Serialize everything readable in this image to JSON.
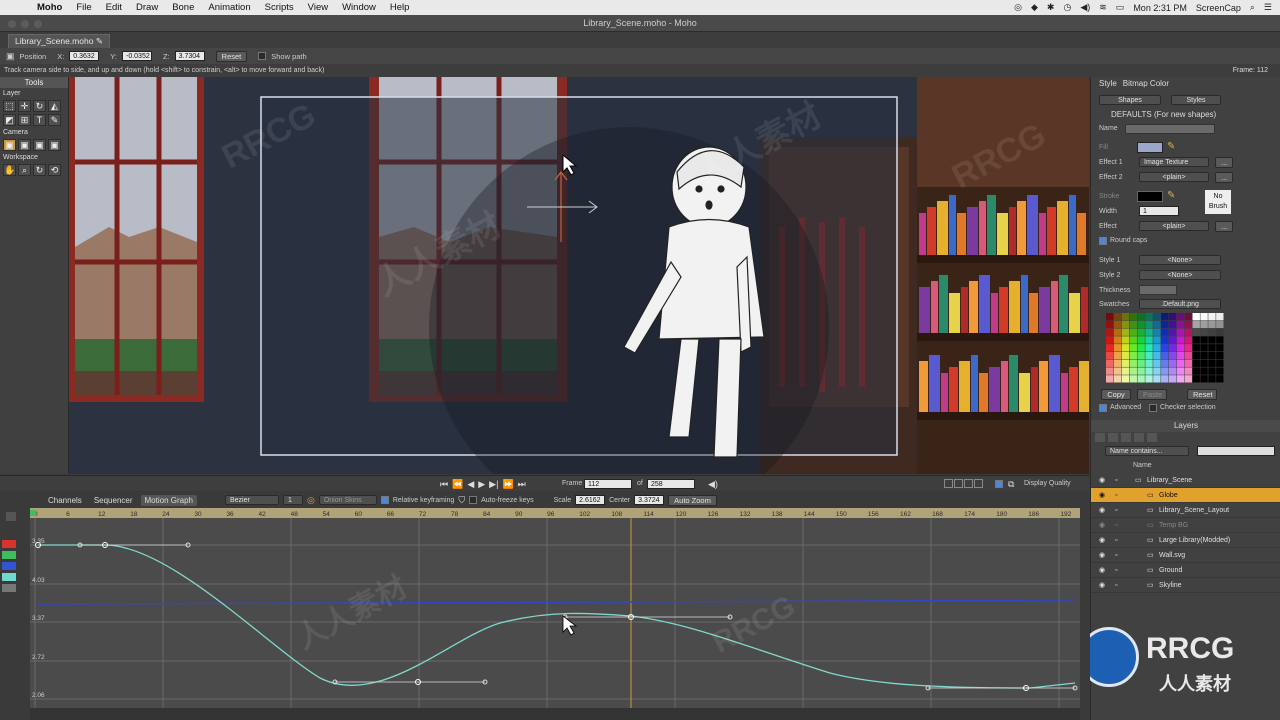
{
  "menubar": {
    "app": "Moho",
    "menus": [
      "File",
      "Edit",
      "Draw",
      "Bone",
      "Animation",
      "Scripts",
      "View",
      "Window",
      "Help"
    ],
    "clock": "Mon 2:31 PM",
    "user": "ScreenCap"
  },
  "window": {
    "title": "Library_Scene.moho - Moho",
    "tab": "Library_Scene.moho"
  },
  "tool_options": {
    "tool": "Position",
    "x_label": "X:",
    "x": "0.3632",
    "y_label": "Y:",
    "y": "-0.0352",
    "z_label": "Z:",
    "z": "3.7304",
    "reset": "Reset",
    "show_path": "Show path"
  },
  "hint": "Track camera side to side, and up and down (hold <shift> to constrain, <alt> to move forward and back)",
  "frame_info": "Frame: 112",
  "tools": {
    "header": "Tools",
    "sections": {
      "layer": "Layer",
      "camera": "Camera",
      "workspace": "Workspace"
    }
  },
  "style_panel": {
    "tabs": [
      "Style",
      "Bitmap Color"
    ],
    "shapes": "Shapes",
    "styles": "Styles",
    "defaults": "DEFAULTS (For new shapes)",
    "name_label": "Name",
    "fill_label": "Fill",
    "effect1_label": "Effect 1",
    "effect1": "Image Texture",
    "effect2_label": "Effect 2",
    "effect2": "<plain>",
    "stroke_label": "Stroke",
    "no_brush": "No Brush",
    "width_label": "Width",
    "width": "1",
    "effect_label": "Effect",
    "effect": "<plain>",
    "round_caps": "Round caps",
    "style1_label": "Style 1",
    "style1": "<None>",
    "style2_label": "Style 2",
    "style2": "<None>",
    "thickness_label": "Thickness",
    "swatches_label": "Swatches",
    "swatches": ".Default.png",
    "copy": "Copy",
    "paste": "Paste",
    "reset": "Reset",
    "advanced": "Advanced",
    "checker": "Checker selection",
    "colors": {
      "fill": "#9aa7c8",
      "stroke": "#000000",
      "accent": "#e0a22c"
    }
  },
  "layers_panel": {
    "title": "Layers",
    "filter": "Name contains...",
    "name_header": "Name",
    "layers": [
      {
        "name": "Library_Scene",
        "indent": 0,
        "selected": false,
        "dim": false
      },
      {
        "name": "Globe",
        "indent": 1,
        "selected": true,
        "dim": false
      },
      {
        "name": "Library_Scene_Layout",
        "indent": 1,
        "selected": false,
        "dim": false
      },
      {
        "name": "Temp BG",
        "indent": 1,
        "selected": false,
        "dim": true
      },
      {
        "name": "Large Library(Modded)",
        "indent": 1,
        "selected": false,
        "dim": false
      },
      {
        "name": "Wall.svg",
        "indent": 1,
        "selected": false,
        "dim": false
      },
      {
        "name": "Ground",
        "indent": 1,
        "selected": false,
        "dim": false
      },
      {
        "name": "Skyline",
        "indent": 1,
        "selected": false,
        "dim": false
      }
    ]
  },
  "timeline": {
    "frame_label": "Frame",
    "frame": "112",
    "of_label": "of",
    "total": "258",
    "display_quality": "Display Quality",
    "tabs": [
      "Channels",
      "Sequencer",
      "Motion Graph"
    ],
    "interp": "Bezier",
    "interp_num": "1",
    "onion": "Onion Skins",
    "relative_keyframing": "Relative keyframing",
    "auto_freeze": "Auto-freeze keys",
    "scale_label": "Scale",
    "scale": "2.6162",
    "center_label": "Center",
    "center": "3.3724",
    "auto_zoom": "Auto Zoom",
    "ruler": [
      "0",
      "6",
      "12",
      "18",
      "24",
      "30",
      "36",
      "42",
      "48",
      "54",
      "60",
      "66",
      "72",
      "78",
      "84",
      "90",
      "96",
      "102",
      "108",
      "114",
      "120",
      "126",
      "132",
      "138",
      "144",
      "150",
      "156",
      "162",
      "168",
      "174",
      "180",
      "186",
      "192"
    ],
    "y_labels": [
      "3.35",
      "4.03",
      "3.37",
      "2.72",
      "2.06"
    ]
  },
  "watermark": {
    "brand": "RRCG",
    "brand_cn": "人人素材"
  }
}
